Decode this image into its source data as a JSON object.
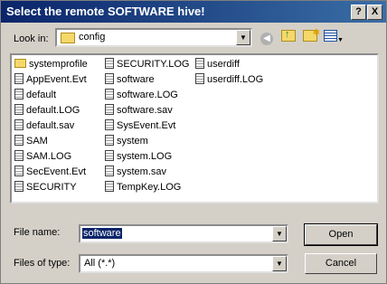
{
  "window": {
    "title": "Select the remote SOFTWARE hive!",
    "help_glyph": "?",
    "close_glyph": "X"
  },
  "toolbar": {
    "look_in_label": "Look in:",
    "look_in_value": "config"
  },
  "files": [
    {
      "name": "systemprofile",
      "type": "folder"
    },
    {
      "name": "AppEvent.Evt",
      "type": "file"
    },
    {
      "name": "default",
      "type": "file"
    },
    {
      "name": "default.LOG",
      "type": "file"
    },
    {
      "name": "default.sav",
      "type": "file"
    },
    {
      "name": "SAM",
      "type": "file"
    },
    {
      "name": "SAM.LOG",
      "type": "file"
    },
    {
      "name": "SecEvent.Evt",
      "type": "file"
    },
    {
      "name": "SECURITY",
      "type": "file"
    },
    {
      "name": "SECURITY.LOG",
      "type": "file"
    },
    {
      "name": "software",
      "type": "file"
    },
    {
      "name": "software.LOG",
      "type": "file"
    },
    {
      "name": "software.sav",
      "type": "file"
    },
    {
      "name": "SysEvent.Evt",
      "type": "file"
    },
    {
      "name": "system",
      "type": "file"
    },
    {
      "name": "system.LOG",
      "type": "file"
    },
    {
      "name": "system.sav",
      "type": "file"
    },
    {
      "name": "TempKey.LOG",
      "type": "file"
    },
    {
      "name": "userdiff",
      "type": "file"
    },
    {
      "name": "userdiff.LOG",
      "type": "file"
    }
  ],
  "form": {
    "file_name_label": "File name:",
    "file_name_value": "software",
    "file_type_label": "Files of type:",
    "file_type_value": "All (*.*)"
  },
  "buttons": {
    "open": "Open",
    "cancel": "Cancel"
  }
}
